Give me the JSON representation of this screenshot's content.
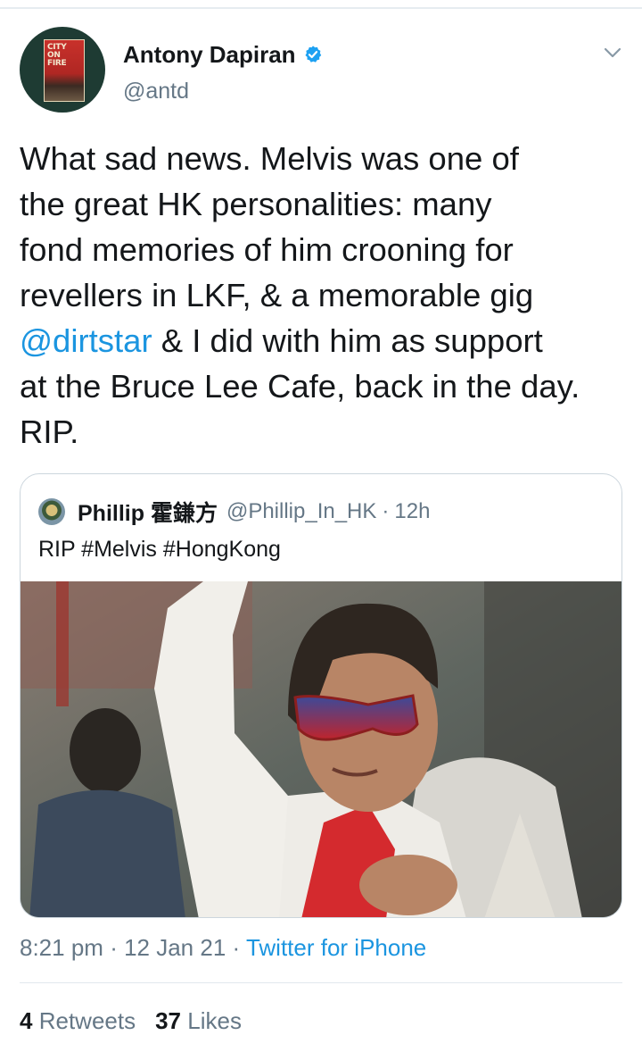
{
  "tweet": {
    "author": {
      "display_name": "Antony Dapiran",
      "handle": "@antd",
      "avatar_text": "CITY ON FIRE"
    },
    "text_before_mention": "What sad news. Melvis was one of\nthe great HK personalities: many\nfond memories of him crooning for\nrevellers in LKF, & a memorable gig\n",
    "mention": "@dirtstar",
    "text_after_mention": " & I did with him as support\nat the Bruce Lee Cafe, back in the day.\nRIP.",
    "time": "8:21 pm",
    "date": "12 Jan 21",
    "source": "Twitter for iPhone",
    "retweets_count": "4",
    "retweets_label": "Retweets",
    "likes_count": "37",
    "likes_label": "Likes"
  },
  "quoted_tweet": {
    "display_name": "Phillip 霍鎌方",
    "handle": "@Phillip_In_HK",
    "age": "12h",
    "text": "RIP #Melvis #HongKong"
  },
  "colors": {
    "link_blue": "#1b95e0",
    "secondary_text": "#657786",
    "verified_blue": "#1da1f2"
  }
}
